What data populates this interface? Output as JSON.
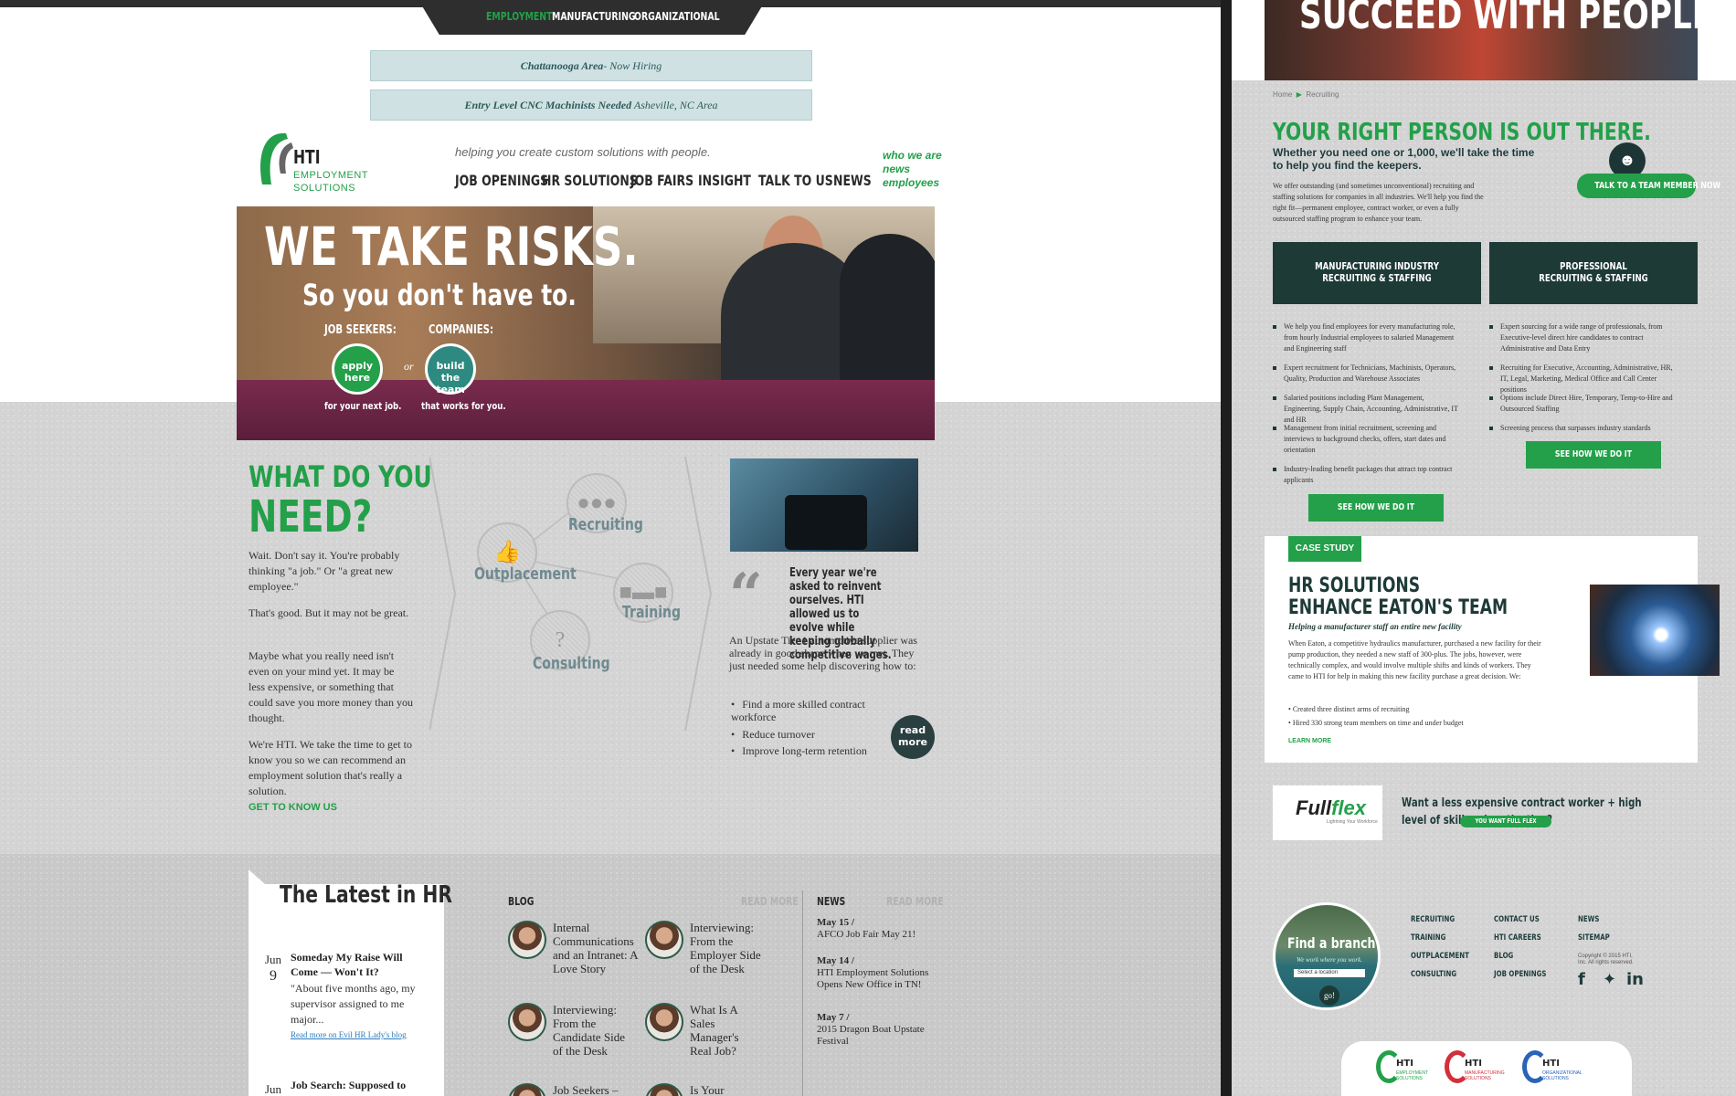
{
  "left": {
    "topnav": [
      "EMPLOYMENT",
      "MANUFACTURING",
      "ORGANIZATIONAL"
    ],
    "notices": [
      {
        "bold": "Chattanooga Area",
        "rest": "- Now Hiring"
      },
      {
        "bold": "Entry Level CNC Machinists Needed",
        "rest": " Asheville, NC Area"
      }
    ],
    "logo": {
      "hti": "HTI",
      "line1": "EMPLOYMENT",
      "line2": "SOLUTIONS"
    },
    "tagline": "helping you create custom solutions with people.",
    "mainnav": [
      "JOB OPENINGS",
      "HR SOLUTIONS",
      "JOB FAIRS",
      "INSIGHT",
      "TALK TO US",
      "NEWS"
    ],
    "sidelinks": [
      "who we are",
      "news",
      "employees"
    ],
    "hero": {
      "headline": "WE TAKE RISKS.",
      "subline": "So you don't have to.",
      "seekers_label": "JOB SEEKERS:",
      "companies_label": "COMPANIES:",
      "apply_btn": "apply here",
      "build_btn": "build the team",
      "or": "or",
      "seekers_sub": "for your next job.",
      "companies_sub": "that works for you."
    },
    "need": {
      "title1": "WHAT DO YOU",
      "title2": "NEED?",
      "paras": [
        "Wait. Don't say it. You're probably thinking \"a job.\" Or \"a great new employee.\"",
        "That's good. But it may not be great.",
        "Maybe what you really need isn't even on your mind yet. It may be less expensive, or something that could save you more money than you thought.",
        "We're HTI. We take the time to get to know you so we can recommend an employment solution that's really a solution."
      ],
      "cta": "GET TO KNOW US"
    },
    "services": {
      "recruiting": "Recruiting",
      "outplacement": "Outplacement",
      "training": "Training",
      "consulting": "Consulting"
    },
    "casestudy": {
      "quote": "Every year we're asked to reinvent ourselves. HTI allowed us to evolve while keeping globally competitive wages.",
      "body": "An Upstate Tier 1 automotive supplier was already in good shape when we met. They just needed some help discovering how to:",
      "bullets": [
        "Find a more skilled contract workforce",
        "Reduce turnover",
        "Improve long-term retention"
      ],
      "read_more": "read more"
    },
    "latest": {
      "title": "The Latest in HR",
      "posts": [
        {
          "month": "Jun",
          "day": "9",
          "title": "Someday My Raise Will Come — Won't It?",
          "excerpt": "\"About five months ago, my supervisor assigned to me major...",
          "link": "Read more on Evil HR Lady's blog"
        },
        {
          "month": "Jun",
          "title": "Job Search: Supposed to"
        }
      ]
    },
    "blog": {
      "label": "BLOG",
      "read_more": "READ MORE",
      "items": [
        "Internal Communications and an Intranet: A Love Story",
        "Interviewing: From the Employer Side of the Desk",
        "Interviewing: From the Candidate Side of the Desk",
        "What Is A Sales Manager's Real Job?",
        "Job Seekers –",
        "Is Your"
      ]
    },
    "news": {
      "label": "NEWS",
      "read_more": "READ MORE",
      "items": [
        {
          "date": "May 15 /",
          "text": "AFCO Job Fair May 21!"
        },
        {
          "date": "May 14 /",
          "text": "HTI Employment Solutions Opens New Office in TN!"
        },
        {
          "date": "May 7 /",
          "text": "2015 Dragon Boat Upstate Festival"
        }
      ]
    }
  },
  "right": {
    "hero_title": "SUCCEED WITH PEOPLE",
    "crumbs": [
      "Home",
      "Recruiting"
    ],
    "title": "YOUR RIGHT PERSON IS OUT THERE.",
    "subtitle": "Whether you need one or 1,000, we'll take the time to help you find the keepers.",
    "intro": "We offer outstanding (and sometimes unconventional) recruiting and staffing solutions for companies in all industries. We'll help you find the right fit—permanent employee, contract worker, or even a fully outsourced staffing program to enhance your team.",
    "talk_btn": "TALK TO A TEAM MEMBER NOW",
    "col1": {
      "title": "MANUFACTURING INDUSTRY RECRUITING & STAFFING",
      "bullets": [
        "We help you find employees for every manufacturing role, from hourly Industrial employees to salaried Management and Engineering staff",
        "Expert recruitment for Technicians, Machinists, Operators, Quality, Production and Warehouse Associates",
        "Salaried positions including Plant Management, Engineering, Supply Chain, Accounting, Administrative, IT and HR",
        "Management from initial recruitment, screening and interviews to background checks, offers, start dates and orientation",
        "Industry-leading benefit packages that attract top contract applicants"
      ],
      "btn": "SEE HOW WE DO IT"
    },
    "col2": {
      "title": "PROFESSIONAL RECRUITING & STAFFING",
      "bullets": [
        "Expert sourcing for a wide range of professionals, from Executive-level direct hire candidates to contract Administrative and Data Entry",
        "Recruiting for Executive, Accounting, Administrative, HR, IT, Legal, Marketing, Medical Office and Call Center positions",
        "Options include Direct Hire, Temporary, Temp-to-Hire and Outsourced Staffing",
        "Screening process that surpasses industry standards"
      ],
      "btn": "SEE HOW WE DO IT"
    },
    "case": {
      "tag": "CASE STUDY",
      "title1": "HR SOLUTIONS",
      "title2": "ENHANCE EATON'S TEAM",
      "subtitle": "Helping a manufacturer staff an entire new facility",
      "body": "When Eaton, a competitive hydraulics manufacturer, purchased a new facility for their pump production, they needed a new staff of 300-plus. The jobs, however, were technically complex, and would involve multiple shifts and kinds of workers. They came to HTI for help in making this new facility purchase a great decision. We:",
      "bullets": [
        "Created three distinct arms of recruiting",
        "Hired 330 strong team members on time and under budget"
      ],
      "learn_more": "LEARN MORE"
    },
    "fullflex": {
      "logo_a": "Full",
      "logo_b": "flex",
      "logo_sub": "Lightning Your Workforce",
      "question": "Want a less expensive contract worker + high level of skill and motivation?",
      "btn": "YOU WANT FULL FLEX"
    },
    "footer": {
      "branch_title": "Find a branch",
      "branch_sub": "We work where you work.",
      "branch_select": "Select a location",
      "go": "go!",
      "col1": [
        "RECRUITING",
        "TRAINING",
        "OUTPLACEMENT",
        "CONSULTING"
      ],
      "col2": [
        "CONTACT US",
        "HTI CAREERS",
        "BLOG",
        "JOB OPENINGS"
      ],
      "col3": [
        "NEWS",
        "SITEMAP"
      ],
      "copyright": "Copyright © 2015 HTI, Inc. All rights reserved.",
      "logos": [
        {
          "name": "HTI",
          "desc": "EMPLOYMENT SOLUTIONS",
          "color": "#23a049"
        },
        {
          "name": "HTI",
          "desc": "MANUFACTURING SOLUTIONS",
          "color": "#d32f3a"
        },
        {
          "name": "HTI",
          "desc": "ORGANIZATIONAL SOLUTIONS",
          "color": "#2b63b8"
        }
      ]
    }
  },
  "colors": {
    "green": "#23a049",
    "dark": "#1d3a36",
    "grey": "#d4d4d4"
  }
}
